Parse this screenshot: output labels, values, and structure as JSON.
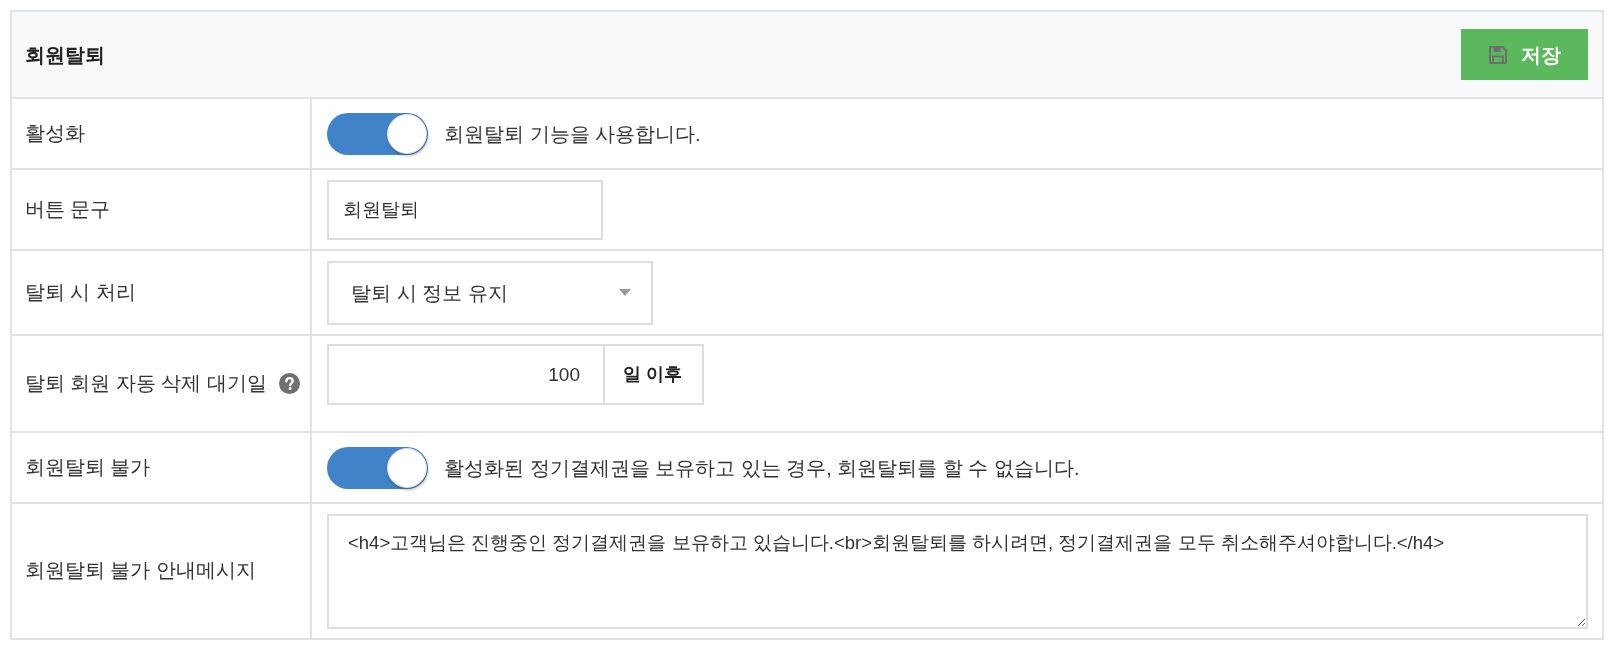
{
  "panel": {
    "title": "회원탈퇴",
    "save_button": {
      "label": "저장"
    }
  },
  "rows": [
    {
      "kind": "toggle",
      "label": "활성화",
      "on": true,
      "description": "회원탈퇴 기능을 사용합니다."
    },
    {
      "kind": "text",
      "label": "버튼 문구",
      "value": "회원탈퇴"
    },
    {
      "kind": "select",
      "label": "탈퇴 시 처리",
      "value": "탈퇴 시 정보 유지"
    },
    {
      "kind": "number",
      "label": "탈퇴 회원 자동 삭제 대기일",
      "help": true,
      "value": "100",
      "suffix": "일 이후"
    },
    {
      "kind": "toggle",
      "label": "회원탈퇴 불가",
      "on": true,
      "description": "활성화된 정기결제권을 보유하고 있는 경우, 회원탈퇴를 할 수 없습니다."
    },
    {
      "kind": "textarea",
      "label": "회원탈퇴 불가 안내메시지",
      "value": "<h4>고객님은 진행중인 정기결제권을 보유하고 있습니다.<br>회원탈퇴를 하시려면, 정기결제권을 모두 취소해주셔야합니다.</h4>"
    }
  ]
}
